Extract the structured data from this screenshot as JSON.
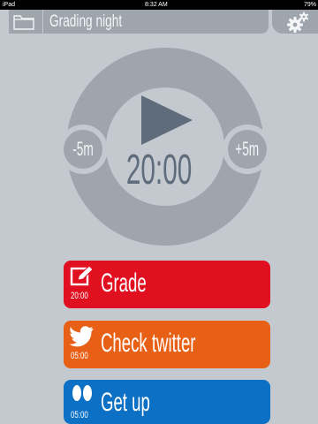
{
  "status_bar": {
    "carrier": "iPad",
    "time": "8:32 AM",
    "battery": "79%"
  },
  "header": {
    "title": "Grading night",
    "folder_icon": "folder-icon",
    "settings_icon": "gear-icon"
  },
  "timer": {
    "time": "20:00",
    "minus_label": "-5m",
    "plus_label": "+5m",
    "play_icon": "play-icon"
  },
  "activities": [
    {
      "label": "Grade",
      "duration": "20:00",
      "icon": "pencil-icon",
      "color": "#e01020"
    },
    {
      "label": "Check twitter",
      "duration": "05:00",
      "icon": "twitter-bird-icon",
      "color": "#e76015"
    },
    {
      "label": "Get up",
      "duration": "05:00",
      "icon": "footprints-icon",
      "color": "#0c70c4"
    }
  ],
  "colors": {
    "background": "#c4c9cf",
    "bar": "#9ea5ad",
    "dial_text": "#5e6c7b"
  }
}
